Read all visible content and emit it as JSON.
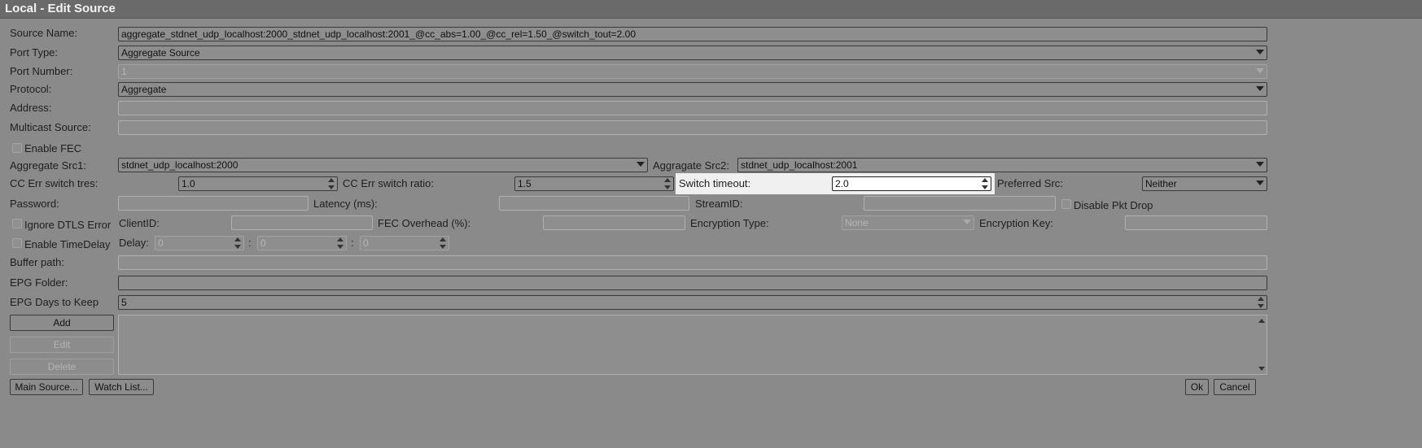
{
  "window": {
    "title": "Local - Edit Source"
  },
  "form": {
    "source_name": {
      "label": "Source Name:",
      "value": "aggregate_stdnet_udp_localhost:2000_stdnet_udp_localhost:2001_@cc_abs=1.00_@cc_rel=1.50_@switch_tout=2.00"
    },
    "port_type": {
      "label": "Port Type:",
      "value": "Aggregate Source"
    },
    "port_number": {
      "label": "Port Number:",
      "value": "1"
    },
    "protocol": {
      "label": "Protocol:",
      "value": "Aggregate"
    },
    "address": {
      "label": "Address:",
      "value": ""
    },
    "multicast_source": {
      "label": "Multicast Source:",
      "value": ""
    },
    "enable_fec": {
      "label": "Enable FEC",
      "checked": false
    },
    "aggregate_src1": {
      "label": "Aggregate Src1:",
      "value": "stdnet_udp_localhost:2000"
    },
    "aggregate_src2": {
      "label": "Aggragate Src2:",
      "value": "stdnet_udp_localhost:2001"
    },
    "cc_err_switch_tres": {
      "label": "CC Err switch tres:",
      "value": "1.0"
    },
    "cc_err_switch_ratio": {
      "label": "CC Err switch ratio:",
      "value": "1.5"
    },
    "switch_timeout": {
      "label": "Switch timeout:",
      "value": "2.0"
    },
    "preferred_src": {
      "label": "Preferred Src:",
      "value": "Neither"
    },
    "password": {
      "label": "Password:",
      "value": ""
    },
    "latency": {
      "label": "Latency (ms):",
      "value": ""
    },
    "stream_id": {
      "label": "StreamID:",
      "value": ""
    },
    "disable_pkt_drop": {
      "label": "Disable Pkt Drop",
      "checked": false
    },
    "ignore_dtls_error": {
      "label": "Ignore DTLS Error",
      "checked": false
    },
    "client_id": {
      "label": "ClientID:",
      "value": ""
    },
    "fec_overhead": {
      "label": "FEC Overhead (%):",
      "value": ""
    },
    "encryption_type": {
      "label": "Encryption Type:",
      "value": "None"
    },
    "encryption_key": {
      "label": "Encryption Key:",
      "value": ""
    },
    "enable_timedelay": {
      "label": "Enable TimeDelay",
      "checked": false
    },
    "delay": {
      "label": "Delay:",
      "h": "0",
      "m": "0",
      "s": "0",
      "sep": ":"
    },
    "buffer_path": {
      "label": "Buffer path:",
      "value": ""
    },
    "epg_folder": {
      "label": "EPG Folder:",
      "value": ""
    },
    "epg_days": {
      "label": "EPG Days to Keep",
      "value": "5"
    }
  },
  "buttons": {
    "add": "Add",
    "edit": "Edit",
    "delete": "Delete",
    "main_source": "Main Source...",
    "watch_list": "Watch List...",
    "ok": "Ok",
    "cancel": "Cancel"
  }
}
